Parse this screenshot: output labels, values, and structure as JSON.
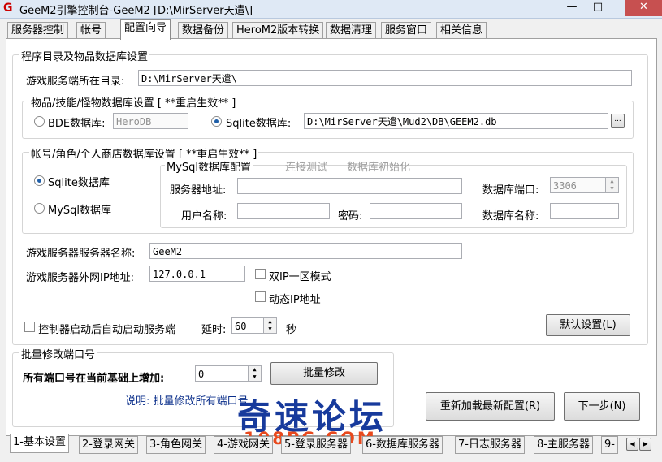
{
  "window": {
    "title": "GeeM2引擎控制台-GeeM2 [D:\\MirServer天遣\\]",
    "app_icon": "G"
  },
  "top_tabs": [
    "服务器控制",
    "帐号",
    "配置向导",
    "数据备份",
    "HeroM2版本转换",
    "数据清理",
    "服务窗口",
    "相关信息"
  ],
  "section1": {
    "title": "程序目录及物品数据库设置",
    "server_dir_label": "游戏服务端所在目录:",
    "server_dir_value": "D:\\MirServer天遣\\",
    "itemdb": {
      "title": "物品/技能/怪物数据库设置 [ **重启生效** ]",
      "bde_label": "BDE数据库:",
      "bde_value": "HeroDB",
      "sqlite_label": "Sqlite数据库:",
      "sqlite_value": "D:\\MirServer天遣\\Mud2\\DB\\GEEM2.db",
      "browse_label": "..."
    },
    "accountdb": {
      "title": "帐号/角色/个人商店数据库设置  [ **重启生效** ]",
      "sqlite_label": "Sqlite数据库",
      "mysql_label": "MySql数据库",
      "mysql": {
        "title": "MySql数据库配置",
        "test_link": "连接测试",
        "init_link": "数据库初始化",
        "host_label": "服务器地址:",
        "port_label": "数据库端口:",
        "port_value": "3306",
        "user_label": "用户名称:",
        "password_label": "密码:",
        "dbname_label": "数据库名称:"
      }
    },
    "server_name_label": "游戏服务器服务器名称:",
    "server_name_value": "GeeM2",
    "external_ip_label": "游戏服务器外网IP地址:",
    "external_ip_value": "127.0.0.1",
    "dual_ip_label": "双IP一区模式",
    "dynamic_ip_label": "动态IP地址",
    "autostart_label": "控制器启动后自动启动服务端",
    "delay_label": "延时:",
    "delay_value": "60",
    "delay_unit": "秒",
    "default_button": "默认设置(L)"
  },
  "batch": {
    "title": "批量修改端口号",
    "increase_label": "所有端口号在当前基础上增加:",
    "increase_value": "0",
    "modify_button": "批量修改",
    "note": "说明: 批量修改所有端口号"
  },
  "reload_button": "重新加载最新配置(R)",
  "next_button": "下一步(N)",
  "bottom_tabs": [
    "1-基本设置",
    "2-登录网关",
    "3-角色网关",
    "4-游戏网关",
    "5-登录服务器",
    "6-数据库服务器",
    "7-日志服务器",
    "8-主服务器",
    "9-"
  ],
  "watermark": {
    "text": "奇速论坛",
    "sub": "108PC.COM"
  }
}
